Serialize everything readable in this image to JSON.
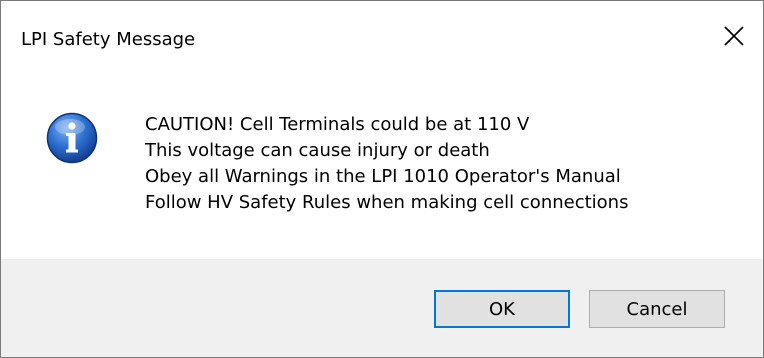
{
  "dialog": {
    "title": "LPI Safety Message",
    "icon": "info-icon",
    "message_lines": [
      "CAUTION! Cell Terminals could be at 110 V",
      "This voltage can cause injury or death",
      "Obey all Warnings in the LPI 1010 Operator's Manual",
      "Follow HV Safety Rules when making cell connections"
    ],
    "buttons": {
      "ok_label": "OK",
      "cancel_label": "Cancel"
    },
    "close_icon": "close-icon"
  },
  "colors": {
    "button_bar_bg": "#f0f0f0",
    "default_button_border": "#0078d7",
    "button_bg": "#e1e1e1",
    "info_icon_blue": "#1d5fc4"
  }
}
